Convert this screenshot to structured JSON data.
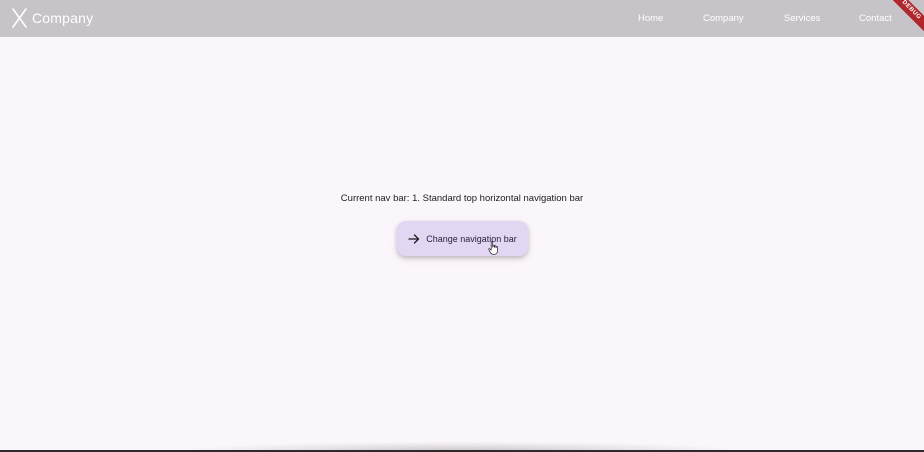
{
  "app": {
    "brand_text": "Company",
    "brand_mark": "X"
  },
  "navbar": {
    "items": [
      {
        "label": "Home"
      },
      {
        "label": "Company"
      },
      {
        "label": "Services"
      },
      {
        "label": "Contact"
      }
    ],
    "debug_banner": "DEBUG"
  },
  "main": {
    "status_text": "Current nav bar: 1. Standard top horizontal navigation bar",
    "button_label": "Change navigation bar",
    "button_icon": "arrow-right-icon"
  },
  "colors": {
    "topbar": "#c7c3c9",
    "background": "#fbf6fc",
    "button": "#e2d7f3",
    "debug_banner": "#b0262d"
  }
}
